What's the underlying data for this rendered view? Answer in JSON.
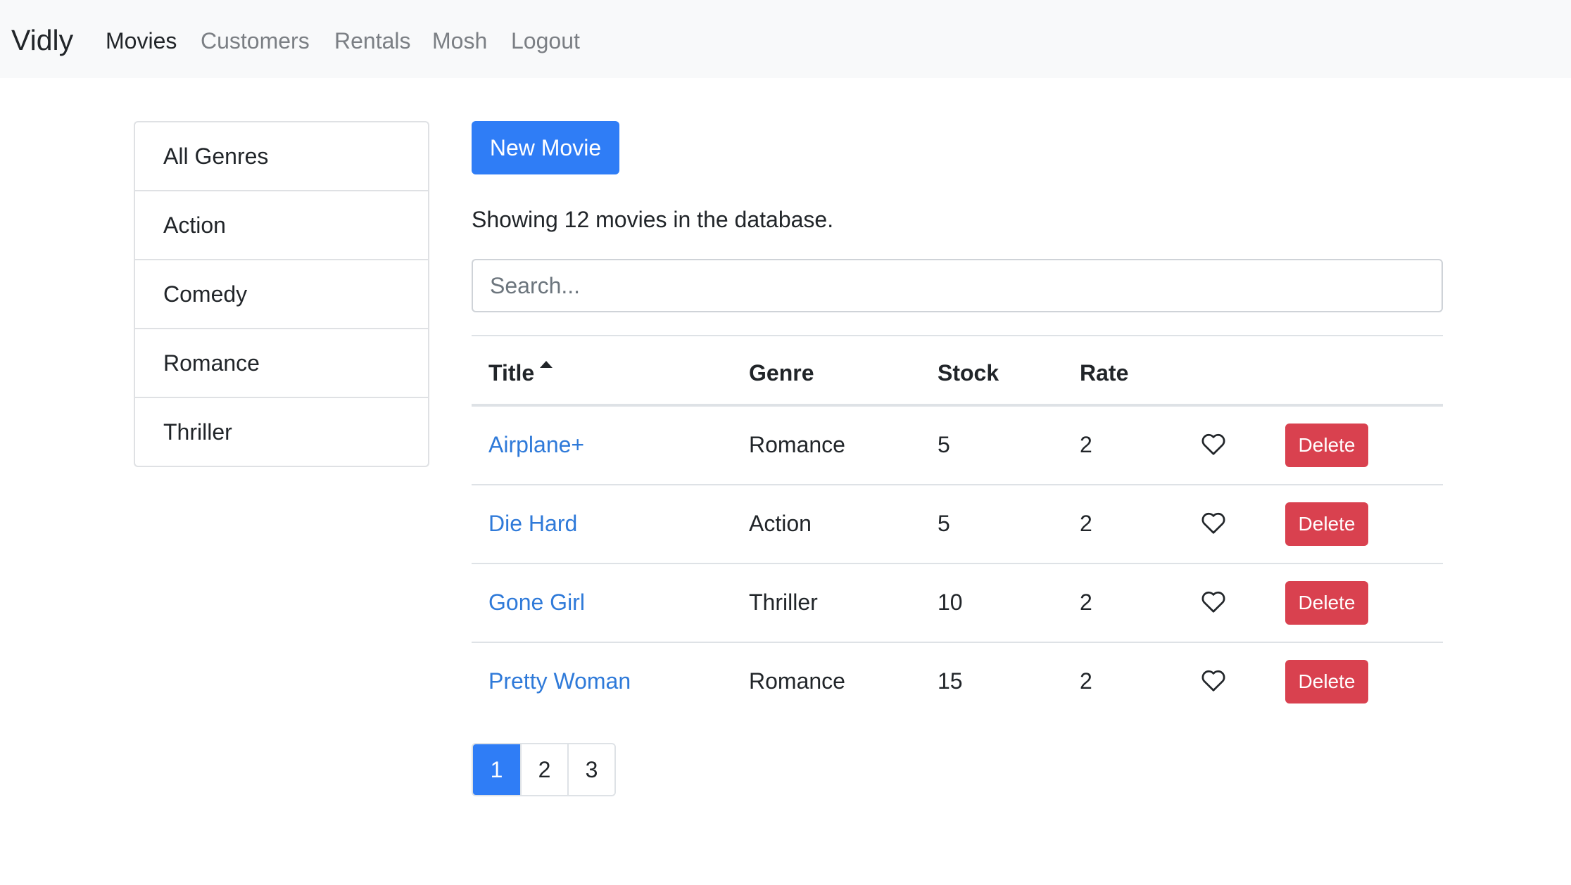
{
  "navbar": {
    "brand": "Vidly",
    "links": [
      {
        "label": "Movies",
        "active": true
      },
      {
        "label": "Customers",
        "active": false
      },
      {
        "label": "Rentals",
        "active": false
      },
      {
        "label": "Mosh",
        "active": false
      },
      {
        "label": "Logout",
        "active": false
      }
    ]
  },
  "genres": [
    "All Genres",
    "Action",
    "Comedy",
    "Romance",
    "Thriller"
  ],
  "main": {
    "new_movie_label": "New Movie",
    "count_text": "Showing 12 movies in the database.",
    "search_placeholder": "Search...",
    "search_value": ""
  },
  "table": {
    "headers": {
      "title": "Title",
      "genre": "Genre",
      "stock": "Stock",
      "rate": "Rate"
    },
    "sort_indicator": "caret-up-icon",
    "rows": [
      {
        "title": "Airplane+",
        "genre": "Romance",
        "stock": "5",
        "rate": "2",
        "like_icon": "heart-outline-icon",
        "delete_label": "Delete"
      },
      {
        "title": "Die Hard",
        "genre": "Action",
        "stock": "5",
        "rate": "2",
        "like_icon": "heart-outline-icon",
        "delete_label": "Delete"
      },
      {
        "title": "Gone Girl",
        "genre": "Thriller",
        "stock": "10",
        "rate": "2",
        "like_icon": "heart-outline-icon",
        "delete_label": "Delete"
      },
      {
        "title": "Pretty Woman",
        "genre": "Romance",
        "stock": "15",
        "rate": "2",
        "like_icon": "heart-outline-icon",
        "delete_label": "Delete"
      }
    ]
  },
  "pagination": {
    "pages": [
      "1",
      "2",
      "3"
    ],
    "current": "1"
  },
  "colors": {
    "primary": "#2f7df6",
    "danger": "#d9414f",
    "link": "#2f7ad9",
    "navbar_bg": "#f8f9fa"
  }
}
